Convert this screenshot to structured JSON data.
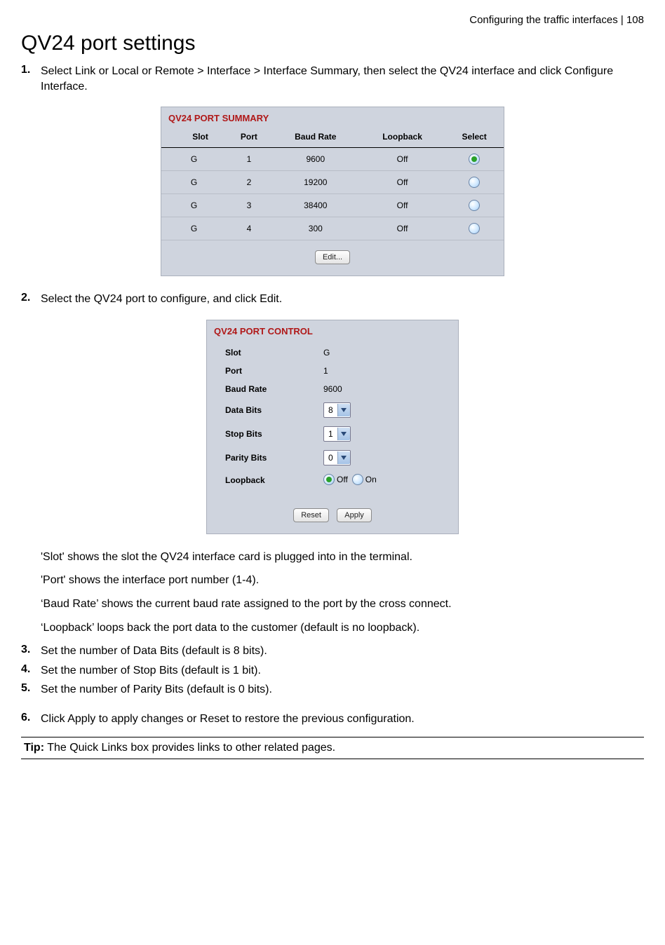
{
  "header": {
    "breadcrumb": "Configuring the traffic interfaces  |  108"
  },
  "title": "QV24 port settings",
  "steps": {
    "s1": {
      "num": "1.",
      "text": "Select Link or Local or Remote > Interface > Interface Summary, then select the QV24 interface and click Configure Interface."
    },
    "s2": {
      "num": "2.",
      "text": "Select the QV24 port to configure, and click Edit."
    },
    "s3": {
      "num": "3.",
      "text": "Set the number of Data Bits (default is 8 bits)."
    },
    "s4": {
      "num": "4.",
      "text": "Set the number of Stop Bits (default is 1 bit)."
    },
    "s5": {
      "num": "5.",
      "text": "Set the number of Parity Bits (default is 0 bits)."
    },
    "s6": {
      "num": "6.",
      "text": "Click Apply to apply changes or Reset to restore the previous configuration."
    }
  },
  "summary": {
    "title": "QV24 PORT SUMMARY",
    "columns": {
      "c1": "Slot",
      "c2": "Port",
      "c3": "Baud Rate",
      "c4": "Loopback",
      "c5": "Select"
    },
    "rows": [
      {
        "slot": "G",
        "port": "1",
        "baud": "9600",
        "loopback": "Off",
        "selected": true
      },
      {
        "slot": "G",
        "port": "2",
        "baud": "19200",
        "loopback": "Off",
        "selected": false
      },
      {
        "slot": "G",
        "port": "3",
        "baud": "38400",
        "loopback": "Off",
        "selected": false
      },
      {
        "slot": "G",
        "port": "4",
        "baud": "300",
        "loopback": "Off",
        "selected": false
      }
    ],
    "edit_label": "Edit..."
  },
  "control": {
    "title": "QV24 PORT CONTROL",
    "labels": {
      "slot": "Slot",
      "port": "Port",
      "baud": "Baud Rate",
      "data_bits": "Data Bits",
      "stop_bits": "Stop Bits",
      "parity_bits": "Parity Bits",
      "loopback": "Loopback"
    },
    "values": {
      "slot": "G",
      "port": "1",
      "baud": "9600",
      "data_bits": "8",
      "stop_bits": "1",
      "parity_bits": "0"
    },
    "loopback_options": {
      "off": "Off",
      "on": "On",
      "selected": "off"
    },
    "buttons": {
      "reset": "Reset",
      "apply": "Apply"
    }
  },
  "desc": {
    "p1": "'Slot' shows the slot the QV24 interface card is plugged into in the terminal.",
    "p2": "'Port' shows the interface port number (1-4).",
    "p3": "‘Baud Rate’ shows the current baud rate assigned to the port by the cross connect.",
    "p4": "‘Loopback’ loops back the port data to the customer (default is no loopback)."
  },
  "tip": {
    "label": "Tip:",
    "text": " The Quick Links box provides links to other related pages."
  }
}
